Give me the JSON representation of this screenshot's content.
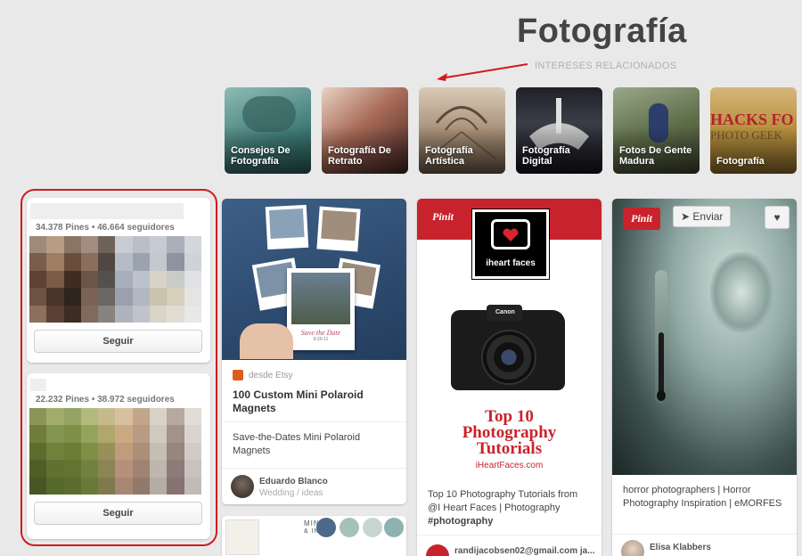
{
  "header": {
    "title": "Fotografía",
    "related_label": "INTERESES RELACIONADOS"
  },
  "interests": [
    {
      "label": "Consejos De Fotografía",
      "color": "#4f8f8a"
    },
    {
      "label": "Fotografía De Retrato",
      "color": "#5a3a33"
    },
    {
      "label": "Fotografía Artística",
      "color": "#a18b74"
    },
    {
      "label": "Fotografía Digital",
      "color": "#2c2f38"
    },
    {
      "label": "Fotos De Gente Madura",
      "color": "#6f6a4f"
    },
    {
      "label": "Fotografía",
      "color": "#b79a46"
    }
  ],
  "boards": [
    {
      "stats": "34.378 Pines • 46.664 seguidores",
      "follow": "Seguir"
    },
    {
      "stats": "22.232 Pines • 38.972 seguidores",
      "follow": "Seguir"
    }
  ],
  "pins": {
    "polaroid": {
      "source": "desde Etsy",
      "title": "100 Custom Mini Polaroid Magnets",
      "description": "Save-the-Dates Mini Polaroid Magnets",
      "author": "Eduardo Blanco",
      "board": "Wedding / ideas",
      "polaroid_caption": "Save the Date",
      "polaroid_date": "9-20-11"
    },
    "ihf": {
      "pinit": "Pinit",
      "logo_text": "iheart faces",
      "headline_1": "Top 10",
      "headline_2": "Photography",
      "headline_3": "Tutorials",
      "site": "iHeartFaces.com",
      "camera_brand": "Canon",
      "description": "Top 10 Photography Tutorials from @I Heart Faces | Photography",
      "hashtag": "#photography",
      "author": "randijacobsen02@gmail.com ja..."
    },
    "horror": {
      "pinit": "Pinit",
      "send": "Enviar",
      "description": "horror photographers | Horror Photography Inspiration | eMORFES",
      "author": "Elisa Klabbers"
    },
    "bottom": {
      "mint": "MINT",
      "ink": "& INK"
    }
  },
  "colors": {
    "accent_red": "#c8232c",
    "circle_red": "#d01c1c"
  }
}
